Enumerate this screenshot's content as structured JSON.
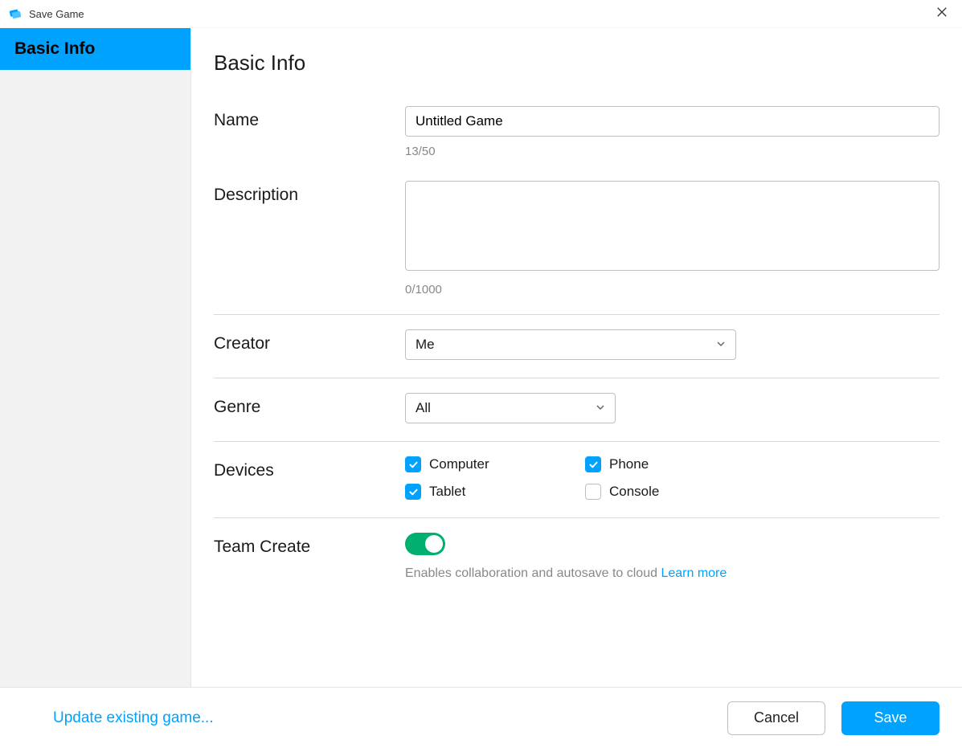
{
  "window": {
    "title": "Save Game"
  },
  "sidebar": {
    "items": [
      {
        "label": "Basic Info",
        "active": true
      }
    ]
  },
  "page": {
    "title": "Basic Info"
  },
  "fields": {
    "name": {
      "label": "Name",
      "value": "Untitled Game",
      "counter": "13/50"
    },
    "description": {
      "label": "Description",
      "value": "",
      "counter": "0/1000"
    },
    "creator": {
      "label": "Creator",
      "value": "Me"
    },
    "genre": {
      "label": "Genre",
      "value": "All"
    },
    "devices": {
      "label": "Devices",
      "options": [
        {
          "label": "Computer",
          "checked": true
        },
        {
          "label": "Phone",
          "checked": true
        },
        {
          "label": "Tablet",
          "checked": true
        },
        {
          "label": "Console",
          "checked": false
        }
      ]
    },
    "teamCreate": {
      "label": "Team Create",
      "enabled": true,
      "hint": "Enables collaboration and autosave to cloud ",
      "learnMore": "Learn more"
    }
  },
  "footer": {
    "updateLink": "Update existing game...",
    "cancel": "Cancel",
    "save": "Save"
  },
  "colors": {
    "accent": "#00a2ff",
    "toggleOn": "#00b06f"
  }
}
